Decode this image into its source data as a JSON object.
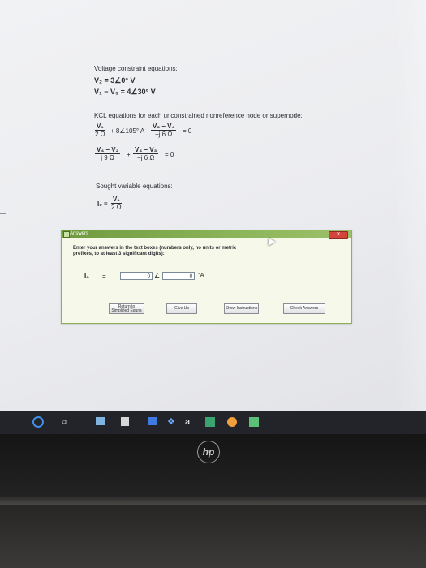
{
  "document": {
    "voltage_constraint_heading": "Voltage constraint equations:",
    "constraint_1": "V₂ = 3∠0° V",
    "constraint_2": "V₁ − V₃ = 4∠30° V",
    "kcl_heading": "KCL equations for each unconstrained nonreference node or supernode:",
    "kcl1": {
      "frac1_num": "V₁",
      "frac1_den": "2 Ω",
      "middle": "+ 8∠105° A +",
      "frac2_num": "V₃ − V₄",
      "frac2_den": "−j 6 Ω",
      "rhs": "= 0"
    },
    "kcl2": {
      "frac1_num": "V₄ − V₂",
      "frac1_den": "j 9 Ω",
      "middle": "+",
      "frac2_num": "V₄ − V₃",
      "frac2_den": "−j 6 Ω",
      "rhs": "= 0"
    },
    "sought_heading": "Sought variable equations:",
    "sought": {
      "lhs": "I₀ =",
      "num": "V₁",
      "den": "2 Ω"
    }
  },
  "dialog": {
    "title": "Answers",
    "close_label": "✕",
    "instructions": "Enter your answers in the text boxes (numbers only, no units or metric prefixes, to at least 3 significant digits):",
    "answer_label": "I₀",
    "answer_equals": "=",
    "magnitude_value": "0",
    "angle_symbol": "∠",
    "angle_value": "0",
    "angle_unit": "°A",
    "buttons": {
      "return": "Return to Simplified Equns",
      "give_up": "Give Up",
      "show_instructions": "Show Instructions",
      "check_answers": "Check Answers"
    }
  },
  "taskbar": {
    "task_view": "⧉",
    "dropbox": "❖",
    "amazon": "a",
    "icons": [
      "start-icon",
      "task-view-icon",
      "file-explorer-icon",
      "store-icon",
      "mail-icon",
      "dropbox-icon",
      "amazon-icon",
      "photos-icon",
      "paint-icon",
      "app-icon"
    ]
  },
  "laptop": {
    "logo": "hp"
  },
  "colors": {
    "dialog_title": "#7ea64b",
    "close_button": "#d5443b",
    "screen_bg": "#eeeff2",
    "taskbar": "#23242a"
  }
}
